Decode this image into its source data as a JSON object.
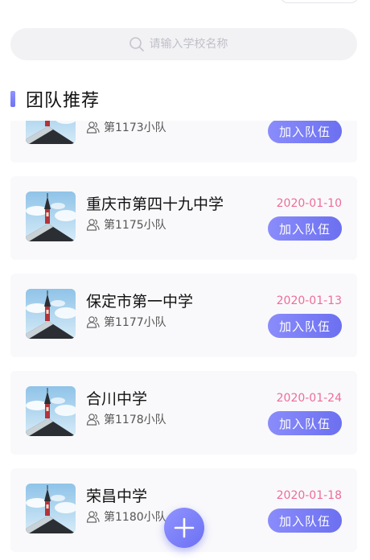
{
  "search": {
    "placeholder": "请输入学校名称",
    "icon": "search-icon"
  },
  "section": {
    "title": "团队推荐"
  },
  "cards": [
    {
      "school": "",
      "team": "第1173小队",
      "date": "",
      "join_label": "加入队伍"
    },
    {
      "school": "重庆市第四十九中学",
      "team": "第1175小队",
      "date": "2020-01-10",
      "join_label": "加入队伍"
    },
    {
      "school": "保定市第一中学",
      "team": "第1177小队",
      "date": "2020-01-13",
      "join_label": "加入队伍"
    },
    {
      "school": "合川中学",
      "team": "第1178小队",
      "date": "2020-01-24",
      "join_label": "加入队伍"
    },
    {
      "school": "荣昌中学",
      "team": "第1180小队",
      "date": "2020-01-18",
      "join_label": "加入队伍"
    }
  ],
  "fab": {
    "icon": "plus-icon"
  },
  "colors": {
    "accent": "#7376f5",
    "date": "#ef6c98",
    "card_bg": "#f9f9fb",
    "search_bg": "#f2f2f5"
  }
}
